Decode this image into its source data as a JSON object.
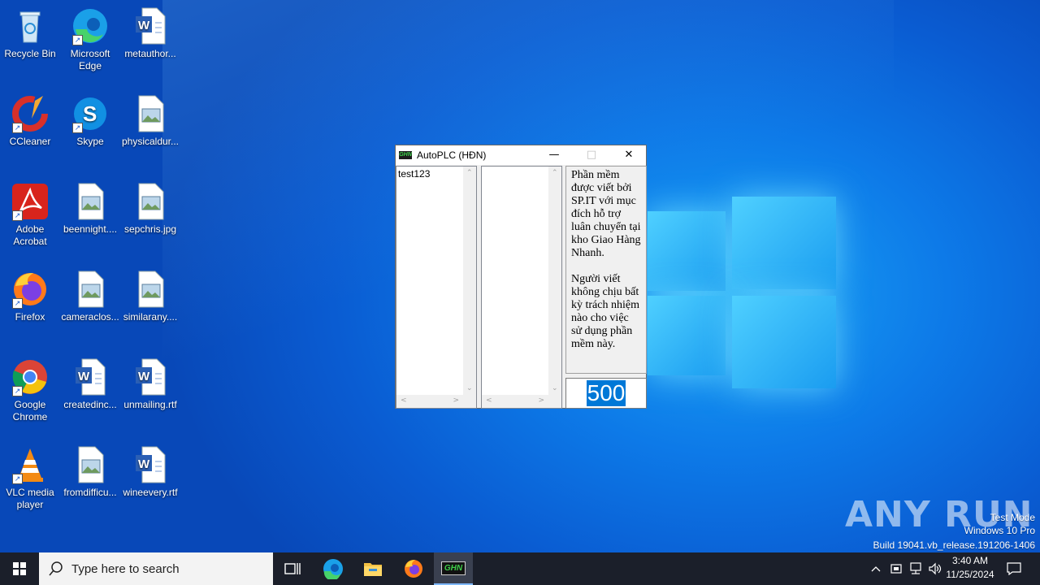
{
  "desktop": {
    "icons": [
      {
        "label": "Recycle Bin"
      },
      {
        "label": "Microsoft Edge"
      },
      {
        "label": "metauthor..."
      },
      {
        "label": "CCleaner"
      },
      {
        "label": "Skype"
      },
      {
        "label": "physicaldur..."
      },
      {
        "label": "Adobe Acrobat"
      },
      {
        "label": "beennight...."
      },
      {
        "label": "sepchris.jpg"
      },
      {
        "label": "Firefox"
      },
      {
        "label": "cameraclos..."
      },
      {
        "label": "similarany...."
      },
      {
        "label": "Google Chrome"
      },
      {
        "label": "createdinc..."
      },
      {
        "label": "unmailing.rtf"
      },
      {
        "label": "VLC media player"
      },
      {
        "label": "fromdifficu..."
      },
      {
        "label": "wineevery.rtf"
      }
    ]
  },
  "window": {
    "app_icon_text": "GHN",
    "title": "AutoPLC (HĐN)",
    "list1_items": [
      "test123"
    ],
    "note": "Phần mềm được viết bởi SP.IT với mục đích hỗ trợ luân chuyển tại kho Giao Hàng Nhanh.\n\nNgười viết không chịu bất kỳ trách nhiệm nào cho việc sử dụng phần mềm này.",
    "number_value": "500"
  },
  "watermark": {
    "brand": "ANY RUN",
    "line1": "Test Mode",
    "line2": "Windows 10 Pro",
    "line3": "Build 19041.vb_release.191206-1406"
  },
  "taskbar": {
    "search_placeholder": "Type here to search",
    "pinned_app_label": "GHN",
    "time": "3:40 AM",
    "date": "11/25/2024"
  }
}
